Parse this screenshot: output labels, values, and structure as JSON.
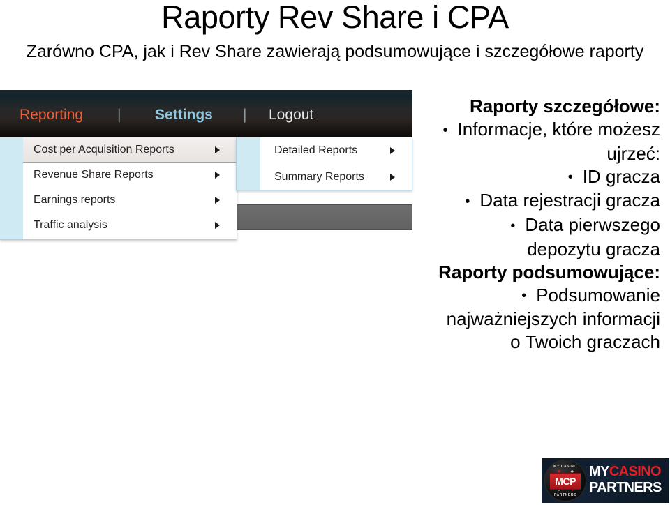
{
  "slide": {
    "title": "Raporty Rev Share i CPA",
    "subtitle": "Zarówno CPA, jak i Rev Share zawierają podsumowujące i szczegółowe raporty"
  },
  "app": {
    "navbar": {
      "reporting": "Reporting",
      "separator_1": "|",
      "settings": "Settings",
      "separator_2": "|",
      "logout": "Logout",
      "reporting_color": "#e8603c",
      "settings_color": "#8fc8e0",
      "logout_color": "#e9e9e9"
    },
    "menu_primary": {
      "items": [
        {
          "label": "Cost per Acquisition Reports",
          "arrow": "▶",
          "selected": true
        },
        {
          "label": "Revenue Share Reports",
          "arrow": "▶",
          "selected": false
        },
        {
          "label": "Earnings reports",
          "arrow": "▶",
          "selected": false
        },
        {
          "label": "Traffic analysis",
          "arrow": "▶",
          "selected": false
        }
      ],
      "accent_color": "#cfeaf3"
    },
    "menu_secondary": {
      "items": [
        {
          "label": "Detailed Reports",
          "arrow": "▶"
        },
        {
          "label": "Summary Reports",
          "arrow": "▶"
        }
      ],
      "accent_color": "#cfeaf3"
    },
    "content_bar_color": "#6e6e6e"
  },
  "bullets": {
    "detailed_heading": "Raporty szczegółowe:",
    "detailed_items": [
      "Informacje, które możesz ujrzeć:",
      "ID gracza",
      "Data rejestracji gracza",
      "Data pierwszego depozytu gracza"
    ],
    "summary_heading": "Raporty podsumowujące:",
    "summary_items": [
      "Podsumowanie najważniejszych informacji o Twoich graczach"
    ],
    "bullet_glyph": "•"
  },
  "logo": {
    "chip_top_text": "MY CASINO",
    "chip_bottom_text": "PARTNERS",
    "chip_center_text": "MCP",
    "word_line1_white": "MY",
    "word_line1_red": "CASINO",
    "word_line2": "PARTNERS",
    "red": "#e02127",
    "suit_heart": "♥",
    "suit_club": "♣",
    "suit_spade": "♠",
    "suit_diamond": "♦"
  }
}
